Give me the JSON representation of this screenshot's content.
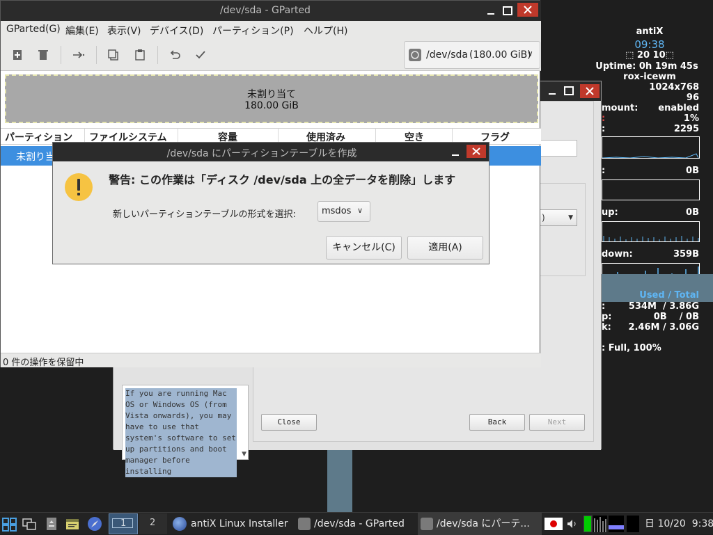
{
  "gparted": {
    "title": "/dev/sda - GParted",
    "menu": [
      "GParted(G)",
      "編集(E)",
      "表示(V)",
      "デバイス(D)",
      "パーティション(P)",
      "ヘルプ(H)"
    ],
    "device": "/dev/sda",
    "device_size": "(180.00 GiB)",
    "graph_label": "未割り当て",
    "graph_size": "180.00 GiB",
    "columns": [
      "パーティション",
      "ファイルシステム",
      "容量",
      "使用済み",
      "空き",
      "フラグ"
    ],
    "row_name": "未割り当",
    "status": "0 件の操作を保留中"
  },
  "dialog": {
    "title": "/dev/sda にパーティションテーブルを作成",
    "warning": "警告: この作業は「ディスク /dev/sda 上の全データを削除」します",
    "select_label": "新しいパーティションテーブルの形式を選択:",
    "select_value": "msdos",
    "cancel": "キャンセル(C)",
    "apply": "適用(A)"
  },
  "installer": {
    "help_text": "If you are running Mac OS or Windows OS (from Vista onwards), you may have to use that system's software to set up partitions and boot manager before installing",
    "close": "Close",
    "back": "Back",
    "next": "Next",
    "combo_value": ")"
  },
  "conky": {
    "host": "antiX",
    "time": "09:38",
    "date": "⬚ 20 10⬚",
    "uptime": "Uptime: 0h 19m 45s",
    "wm": "rox-icewm",
    "resolution": "1024x768",
    "dpi": "96",
    "automount_label": "mount:",
    "automount_value": "enabled",
    "cpu_value": "1%",
    "freq_label": ":",
    "freq_value": "2295",
    "disk_label": ":",
    "disk_value": "0B",
    "up_label": "up:",
    "up_value": "0B",
    "down_label": "down:",
    "down_value": "359B",
    "used_total": "Used / Total",
    "ram_label": ":",
    "ram_value": "534M  / 3.86G",
    "swap_label": "p:",
    "swap_value": "0B    / 0B",
    "disk2_label": "k:",
    "disk2_value": "2.46M / 3.06G",
    "battery": ": Full, 100%"
  },
  "taskbar": {
    "workspace1": "1",
    "workspace2": "2",
    "task_installer": "antiX Linux Installer",
    "task_gparted": "/dev/sda - GParted",
    "task_dialog": "/dev/sda にパーテ...",
    "clock": "日 10/20  9:38"
  }
}
